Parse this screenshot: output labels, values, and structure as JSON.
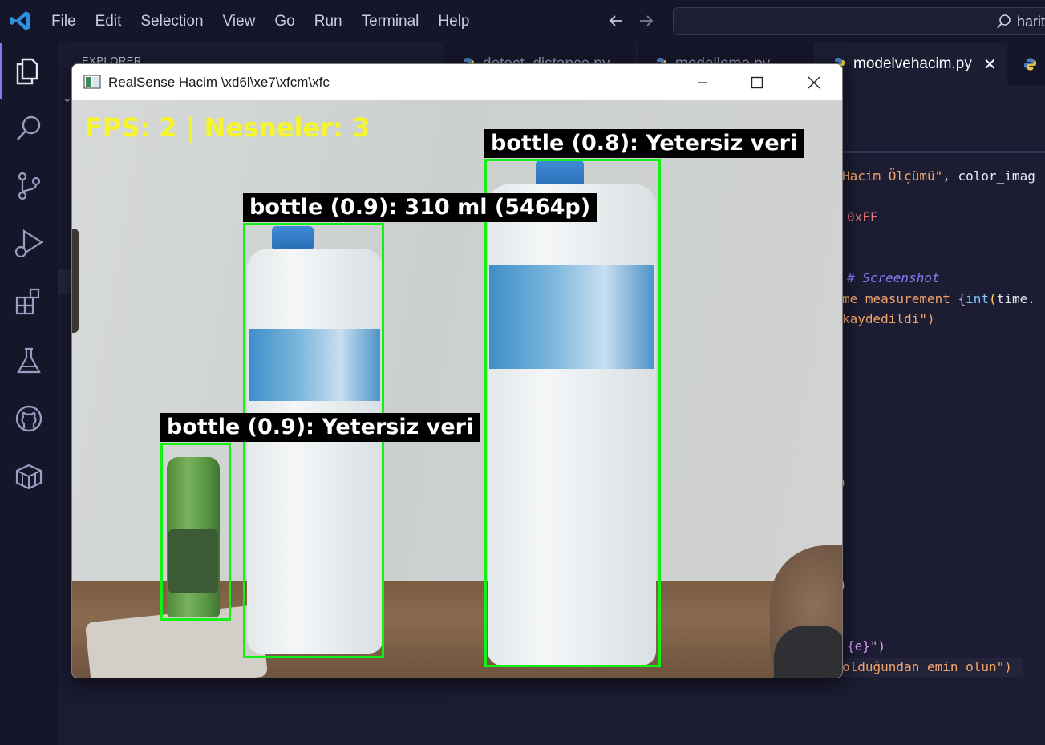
{
  "menubar": {
    "items": [
      "File",
      "Edit",
      "Selection",
      "View",
      "Go",
      "Run",
      "Terminal",
      "Help"
    ],
    "search_text": "harit"
  },
  "sidebar": {
    "title": "EXPLORER",
    "more": "..."
  },
  "tabs": [
    {
      "label": "detect_distance.py",
      "active": false
    },
    {
      "label": "modelleme.py",
      "active": false
    },
    {
      "label": "modelvehacim.py",
      "active": true
    },
    {
      "label": "",
      "active": false
    }
  ],
  "code": {
    "line1_str": "Hacim Ölçümü\"",
    "line1_rest": ", color_imag",
    "line2": "0xFF",
    "line3_comment": "# Screenshot",
    "line4_a": "me_measurement_",
    "line4_b": "{",
    "line4_c": "int",
    "line4_d": "(",
    "line4_e": "time.",
    "line5": "kaydedildi\")",
    "paren1": ")",
    "paren2": ")",
    "line_e": "{e}\")",
    "line_last": "olduğundan emin olun\")"
  },
  "cv_window": {
    "title": "RealSense Hacim \\xd6l\\xe7\\xfcm\\xfc",
    "fps_text": "FPS: 2 | Nesneler: 3",
    "detections": [
      {
        "label": "bottle (0.8): Yetersiz veri",
        "color": "#14f014"
      },
      {
        "label": "bottle (0.9): 310 ml (5464p)",
        "color": "#14f014"
      },
      {
        "label": "bottle (0.9): Yetersiz veri",
        "color": "#14f014"
      }
    ]
  },
  "icons": [
    "vscode-logo-icon",
    "explorer-icon",
    "search-icon",
    "source-control-icon",
    "run-debug-icon",
    "extensions-icon",
    "testing-icon",
    "github-icon",
    "remote-box-icon"
  ]
}
